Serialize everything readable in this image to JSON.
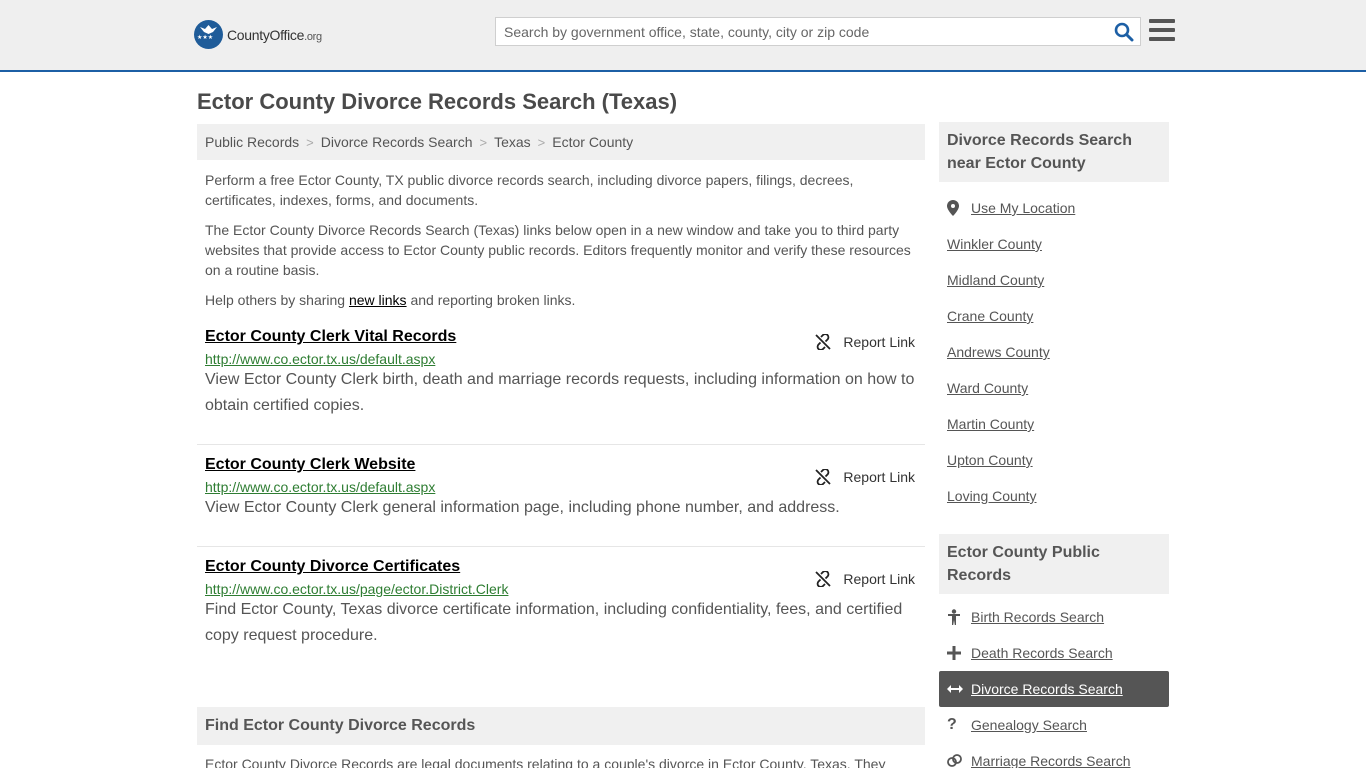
{
  "header": {
    "logo_name": "CountyOffice",
    "logo_tld": ".org",
    "search_placeholder": "Search by government office, state, county, city or zip code"
  },
  "page_title": "Ector County Divorce Records Search (Texas)",
  "breadcrumb": [
    "Public Records",
    "Divorce Records Search",
    "Texas",
    "Ector County"
  ],
  "intro": {
    "p1": "Perform a free Ector County, TX public divorce records search, including divorce papers, filings, decrees, certificates, indexes, forms, and documents.",
    "p2": "The Ector County Divorce Records Search (Texas) links below open in a new window and take you to third party websites that provide access to Ector County public records. Editors frequently monitor and verify these resources on a routine basis.",
    "p3_before": "Help others by sharing ",
    "p3_link": "new links",
    "p3_after": " and reporting broken links."
  },
  "report_label": "Report Link",
  "listings": [
    {
      "title": "Ector County Clerk Vital Records",
      "url": "http://www.co.ector.tx.us/default.aspx",
      "desc": "View Ector County Clerk birth, death and marriage records requests, including information on how to obtain certified copies."
    },
    {
      "title": "Ector County Clerk Website",
      "url": "http://www.co.ector.tx.us/default.aspx",
      "desc": "View Ector County Clerk general information page, including phone number, and address."
    },
    {
      "title": "Ector County Divorce Certificates",
      "url": "http://www.co.ector.tx.us/page/ector.District.Clerk",
      "desc": "Find Ector County, Texas divorce certificate information, including confidentiality, fees, and certified copy request procedure."
    }
  ],
  "find_section": {
    "heading": "Find Ector County Divorce Records",
    "body": "Ector County Divorce Records are legal documents relating to a couple's divorce in Ector County, Texas. They include the divorce papers that the couple files in Ector County Court, as well as any records created during the"
  },
  "sidebar": {
    "nearby_heading": "Divorce Records Search near Ector County",
    "use_location": "Use My Location",
    "nearby": [
      "Winkler County",
      "Midland County",
      "Crane County",
      "Andrews County",
      "Ward County",
      "Martin County",
      "Upton County",
      "Loving County"
    ],
    "public_heading": "Ector County Public Records",
    "public_records": [
      {
        "label": "Birth Records Search",
        "icon": "person-icon"
      },
      {
        "label": "Death Records Search",
        "icon": "plus-icon"
      },
      {
        "label": "Divorce Records Search",
        "icon": "arrows-icon",
        "active": true
      },
      {
        "label": "Genealogy Search",
        "icon": "question-icon"
      },
      {
        "label": "Marriage Records Search",
        "icon": "rings-icon"
      }
    ]
  },
  "colors": {
    "accent_border": "#1c5fa5",
    "url_green": "#2e7d32",
    "active_bg": "#555555"
  }
}
